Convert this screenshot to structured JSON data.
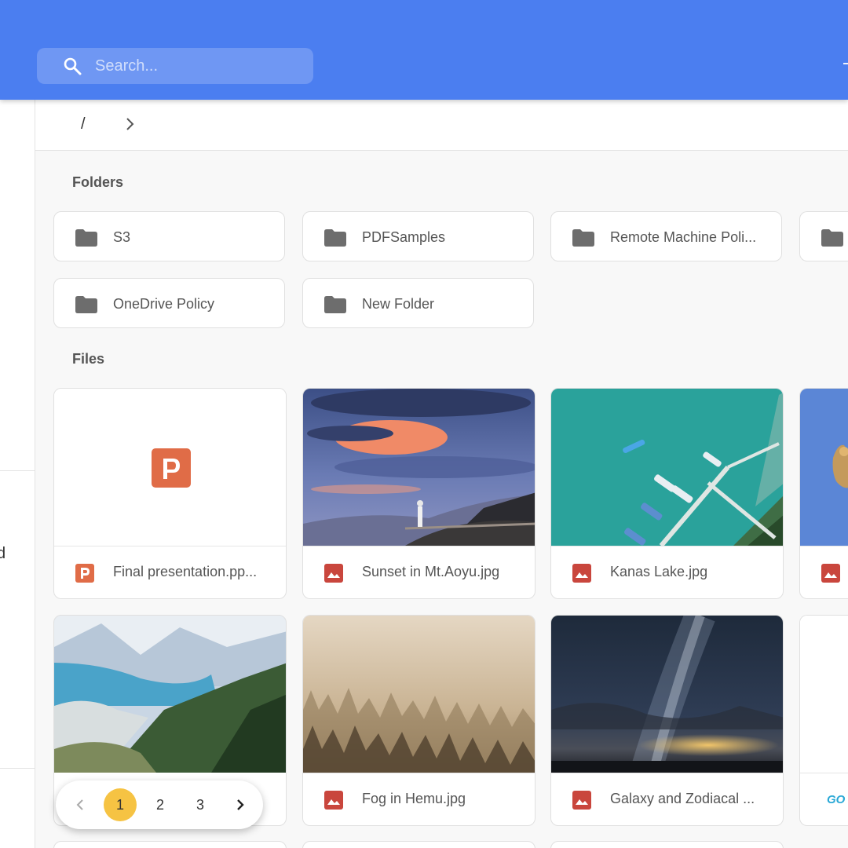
{
  "search": {
    "placeholder": "Search..."
  },
  "sidebar": {
    "fragment": "d"
  },
  "breadcrumb": {
    "root": "/"
  },
  "sections": {
    "folders": "Folders",
    "files": "Files"
  },
  "folders": [
    "S3",
    "PDFSamples",
    "Remote Machine Poli...",
    "",
    "OneDrive Policy",
    "New Folder"
  ],
  "files": [
    {
      "name": "Final presentation.pp...",
      "type": "presentation",
      "icon": "powerpoint-icon"
    },
    {
      "name": "Sunset in Mt.Aoyu.jpg",
      "type": "image",
      "icon": "image-icon"
    },
    {
      "name": "Kanas Lake.jpg",
      "type": "image",
      "icon": "image-icon"
    },
    {
      "name": "",
      "type": "image",
      "icon": "image-icon"
    },
    {
      "name": "",
      "type": "image",
      "icon": "image-icon"
    },
    {
      "name": "Fog in Hemu.jpg",
      "type": "image",
      "icon": "image-icon"
    },
    {
      "name": "Galaxy and Zodiacal ...",
      "type": "image",
      "icon": "image-icon"
    },
    {
      "name": "",
      "type": "file",
      "icon": "go-logo-icon",
      "logo_text": "GO"
    }
  ],
  "pagination": {
    "pages": [
      "1",
      "2",
      "3"
    ],
    "current": "1"
  },
  "colors": {
    "header": "#4b7ef0",
    "pagination_active": "#f6c343",
    "powerpoint": "#e06c47",
    "image_icon": "#c9463d",
    "folder_icon": "#6d6d6d"
  }
}
